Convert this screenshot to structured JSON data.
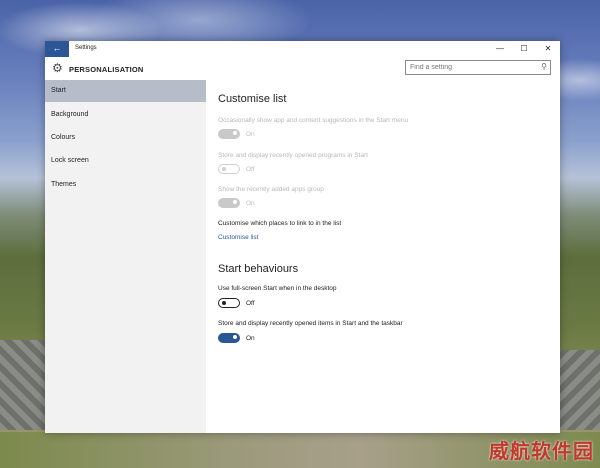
{
  "window": {
    "title": "Settings",
    "back_icon": "back-arrow-icon",
    "controls": {
      "minimize": "—",
      "maximize": "☐",
      "close": "✕"
    }
  },
  "header": {
    "title": "PERSONALISATION",
    "icon": "gear-icon",
    "search_placeholder": "Find a setting"
  },
  "sidebar": {
    "items": [
      {
        "label": "Start",
        "active": true
      },
      {
        "label": "Background",
        "active": false
      },
      {
        "label": "Colours",
        "active": false
      },
      {
        "label": "Lock screen",
        "active": false
      },
      {
        "label": "Themes",
        "active": false
      }
    ]
  },
  "main": {
    "customise_title": "Customise list",
    "suggestions": {
      "label": "Occasionally show app and content suggestions in the Start menu",
      "state": "On",
      "enabled": false
    },
    "recent_programs": {
      "label": "Store and display recently opened programs in Start",
      "state": "Off",
      "enabled": false
    },
    "recent_apps": {
      "label": "Show the recently added apps group",
      "state": "On",
      "enabled": false
    },
    "places_label": "Customise which places to link to in the list",
    "places_link": "Customise list",
    "behaviours_title": "Start behaviours",
    "fullscreen": {
      "label": "Use full-screen Start when in the desktop",
      "state": "Off"
    },
    "recent_items": {
      "label": "Store and display recently opened items in Start and the taskbar",
      "state": "On"
    }
  },
  "watermark": "威航软件园",
  "colors": {
    "accent": "#2b5797",
    "sidebar_active": "#b6bcc8",
    "sidebar_bg": "#f2f2f2"
  }
}
